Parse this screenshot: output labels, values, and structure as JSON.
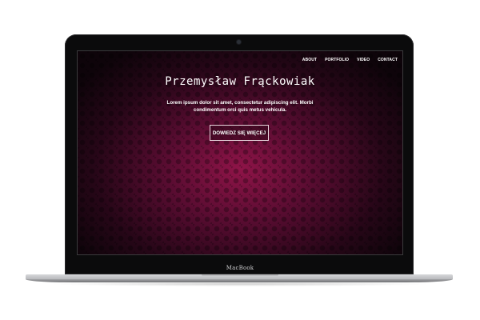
{
  "device": {
    "brand_label": "MacBook"
  },
  "site": {
    "nav": [
      {
        "label": "ABOUT"
      },
      {
        "label": "PORTFOLIO"
      },
      {
        "label": "VIDEO"
      },
      {
        "label": "CONTACT"
      }
    ],
    "hero": {
      "title": "Przemysław Frąckowiak",
      "subtitle": "Lorem ipsum dolor sit amet, consectetur adipiscing elit. Morbi condimentum orci quis metus vehicula.",
      "cta_label": "DOWIEDZ SIĘ WIĘCEJ"
    }
  },
  "colors": {
    "accent": "#96144b",
    "text": "#ffffff"
  }
}
